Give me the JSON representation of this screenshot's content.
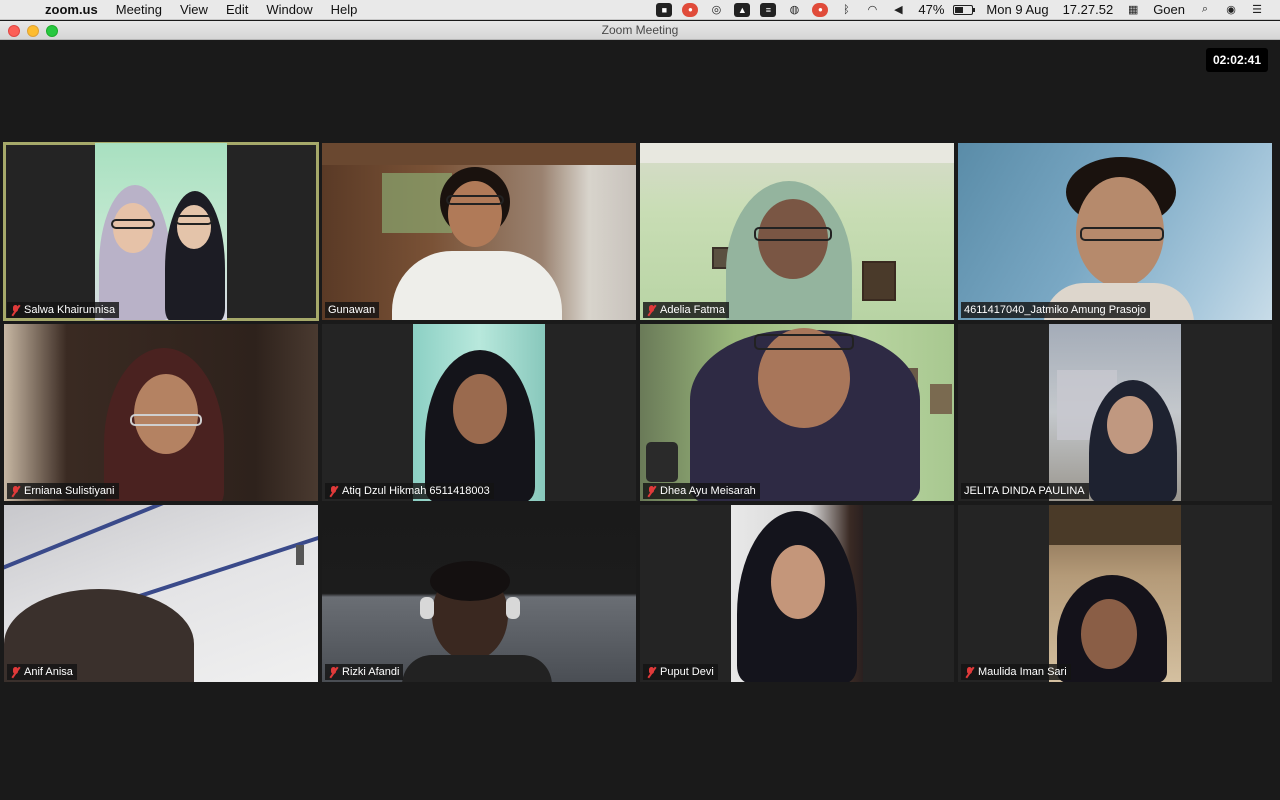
{
  "menubar": {
    "app_name": "zoom.us",
    "menus": [
      "Meeting",
      "View",
      "Edit",
      "Window",
      "Help"
    ],
    "battery_percent": "47%",
    "battery_level": 0.47,
    "date": "Mon 9 Aug",
    "time": "17.27.52",
    "user": "Goen",
    "tray_icons": [
      "zoom-camera-icon",
      "notification-icon",
      "creative-cloud-icon",
      "drive-icon",
      "stack-icon",
      "vpn-icon",
      "record-icon",
      "bluetooth-icon",
      "wifi-icon",
      "volume-icon"
    ]
  },
  "window": {
    "title": "Zoom Meeting"
  },
  "meeting": {
    "elapsed": "02:02:41"
  },
  "participants": [
    {
      "name": "Salwa Khairunnisa",
      "muted": true,
      "active": true
    },
    {
      "name": "Gunawan",
      "muted": false,
      "active": false
    },
    {
      "name": "Adelia Fatma",
      "muted": true,
      "active": false
    },
    {
      "name": "4611417040_Jatmiko Amung Prasojo",
      "muted": false,
      "active": false
    },
    {
      "name": "Erniana Sulistiyani",
      "muted": true,
      "active": false
    },
    {
      "name": "Atiq Dzul Hikmah 6511418003",
      "muted": true,
      "active": false
    },
    {
      "name": "Dhea Ayu Meisarah",
      "muted": true,
      "active": false
    },
    {
      "name": "JELITA DINDA PAULINA",
      "muted": false,
      "active": false
    },
    {
      "name": "Anif Anisa",
      "muted": true,
      "active": false
    },
    {
      "name": "Rizki Afandi",
      "muted": true,
      "active": false
    },
    {
      "name": "Puput Devi",
      "muted": true,
      "active": false
    },
    {
      "name": "Maulida Iman Sari",
      "muted": true,
      "active": false
    }
  ]
}
